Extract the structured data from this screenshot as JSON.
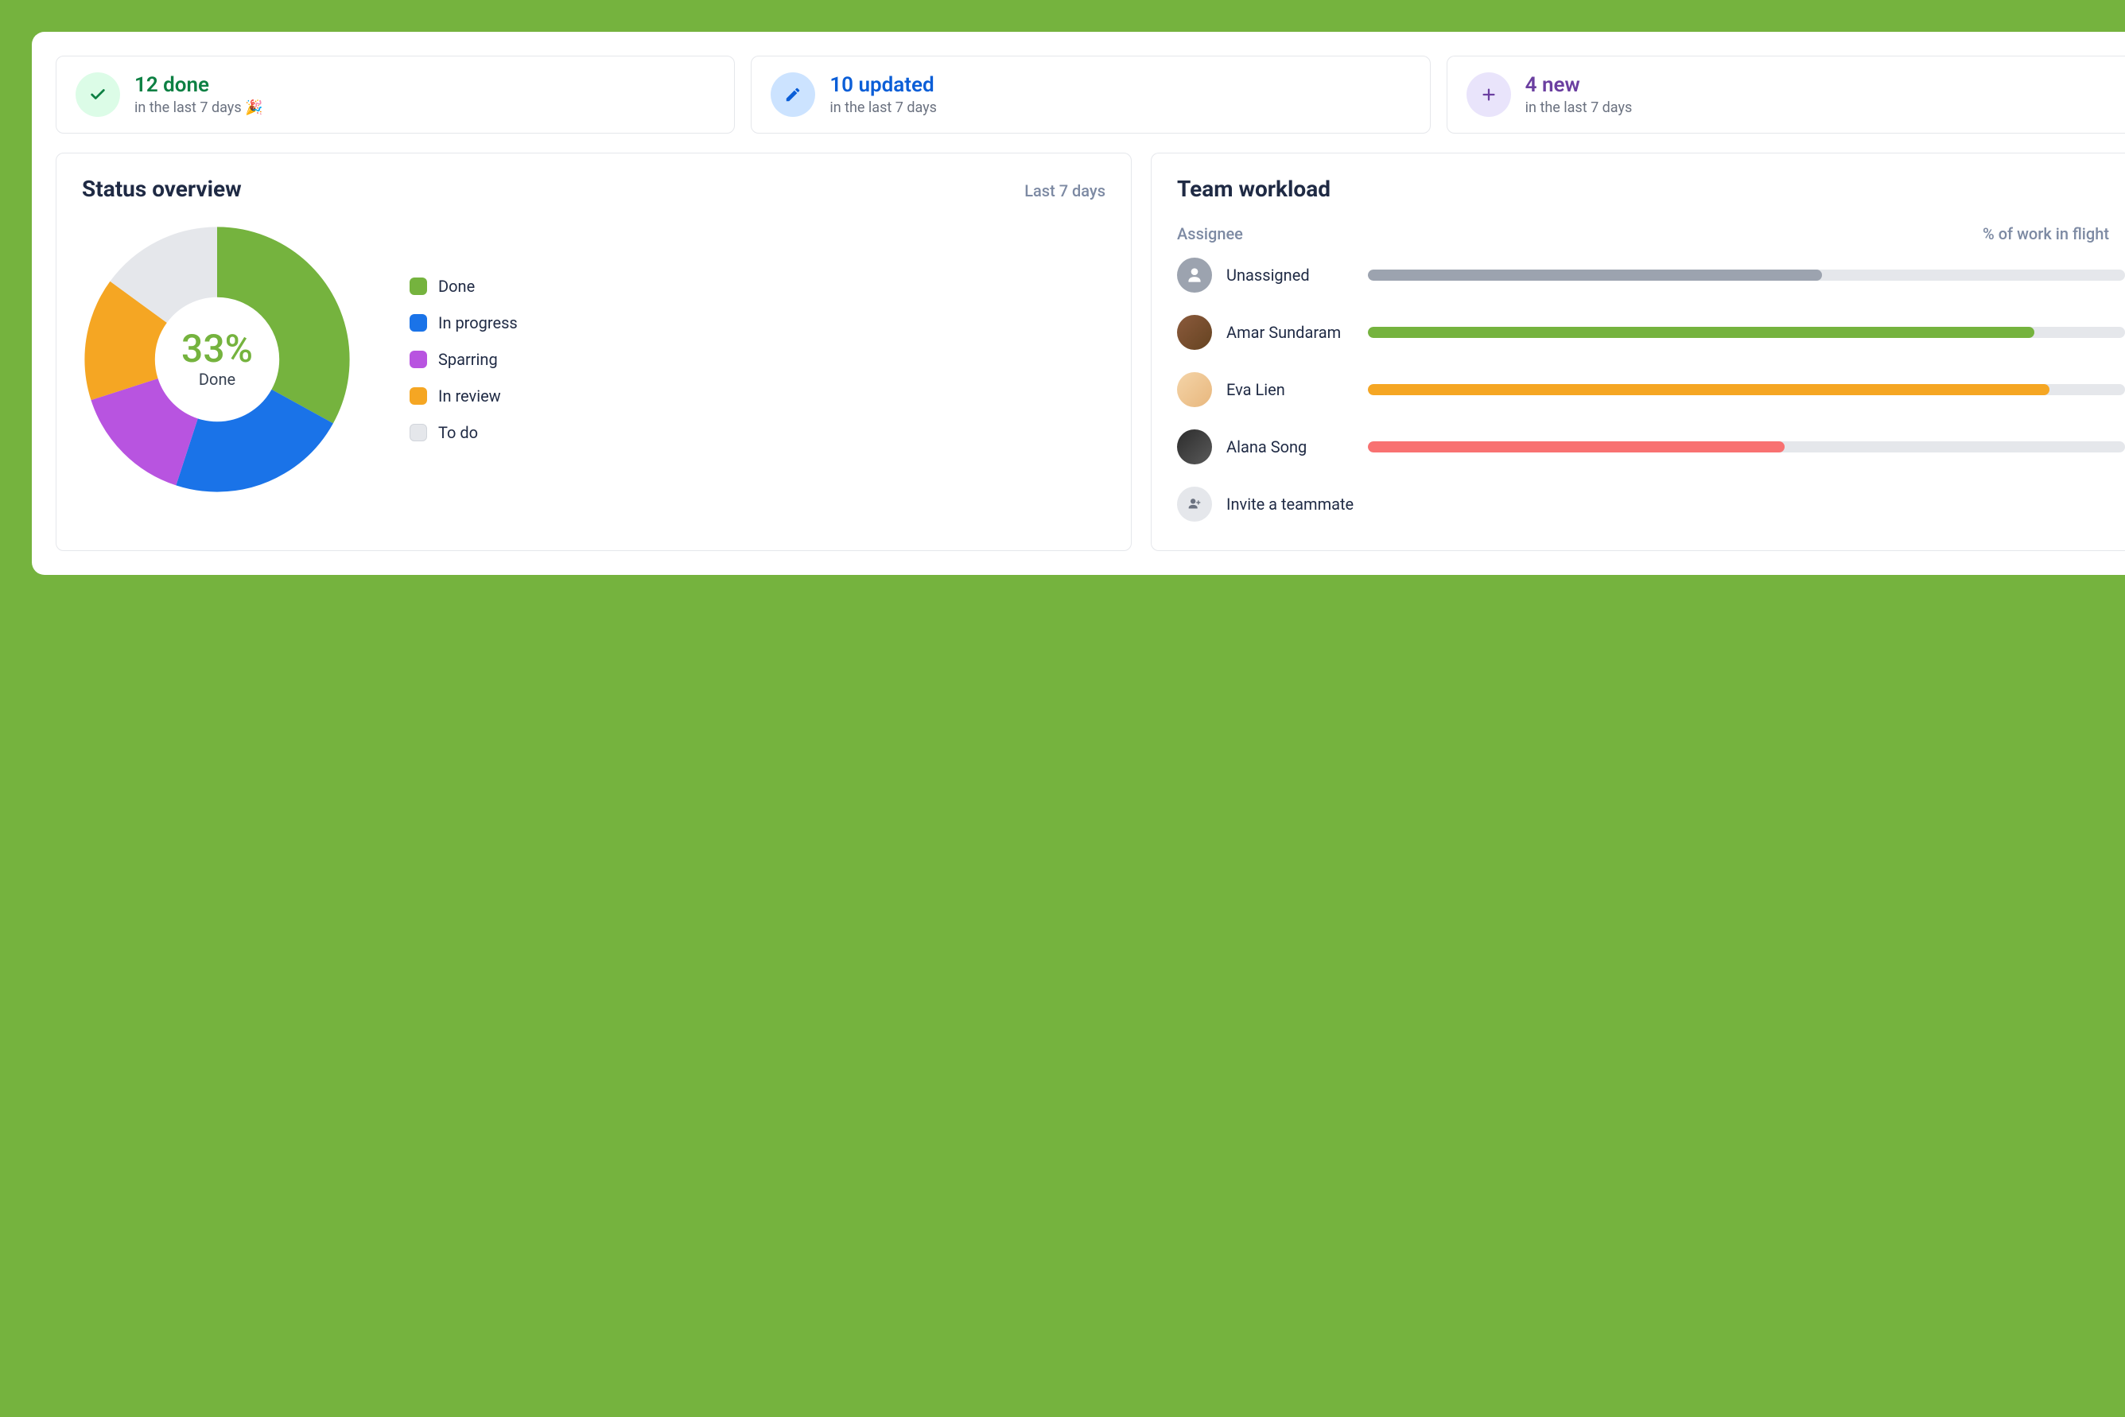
{
  "stats": {
    "done": {
      "title": "12 done",
      "subtitle": "in the last 7 days 🎉",
      "icon": "check-icon",
      "color": "#0d8043",
      "iconBg": "#dcfce7"
    },
    "updated": {
      "title": "10 updated",
      "subtitle": "in the last 7 days",
      "icon": "pencil-icon",
      "color": "#0b5ed7",
      "iconBg": "#cce3ff"
    },
    "new": {
      "title": "4 new",
      "subtitle": "in the last 7 days",
      "icon": "plus-icon",
      "color": "#6b3fa0",
      "iconBg": "#e9e4fb"
    }
  },
  "statusOverview": {
    "title": "Status overview",
    "period": "Last 7 days",
    "centerPercent": "33%",
    "centerLabel": "Done",
    "segments": [
      {
        "label": "Done",
        "value": 33,
        "color": "#75b33e"
      },
      {
        "label": "In progress",
        "value": 22,
        "color": "#1a73e8"
      },
      {
        "label": "Sparring",
        "value": 15,
        "color": "#b854e0"
      },
      {
        "label": "In review",
        "value": 15,
        "color": "#f5a623"
      },
      {
        "label": "To do",
        "value": 15,
        "color": "#e5e7eb"
      }
    ]
  },
  "teamWorkload": {
    "title": "Team workload",
    "assigneeHeader": "Assignee",
    "percentHeader": "% of work in flight",
    "rows": [
      {
        "name": "Unassigned",
        "percent": 60,
        "color": "#9ca3af",
        "avatarType": "unassigned"
      },
      {
        "name": "Amar Sundaram",
        "percent": 88,
        "color": "#75b33e",
        "avatarType": "person1"
      },
      {
        "name": "Eva Lien",
        "percent": 90,
        "color": "#f5a623",
        "avatarType": "person2"
      },
      {
        "name": "Alana Song",
        "percent": 55,
        "color": "#f87171",
        "avatarType": "person3"
      }
    ],
    "inviteLabel": "Invite a teammate"
  },
  "chart_data": {
    "type": "pie",
    "title": "Status overview",
    "categories": [
      "Done",
      "In progress",
      "Sparring",
      "In review",
      "To do"
    ],
    "values": [
      33,
      22,
      15,
      15,
      15
    ],
    "colors": [
      "#75b33e",
      "#1a73e8",
      "#b854e0",
      "#f5a623",
      "#e5e7eb"
    ],
    "center_label": "33% Done"
  }
}
